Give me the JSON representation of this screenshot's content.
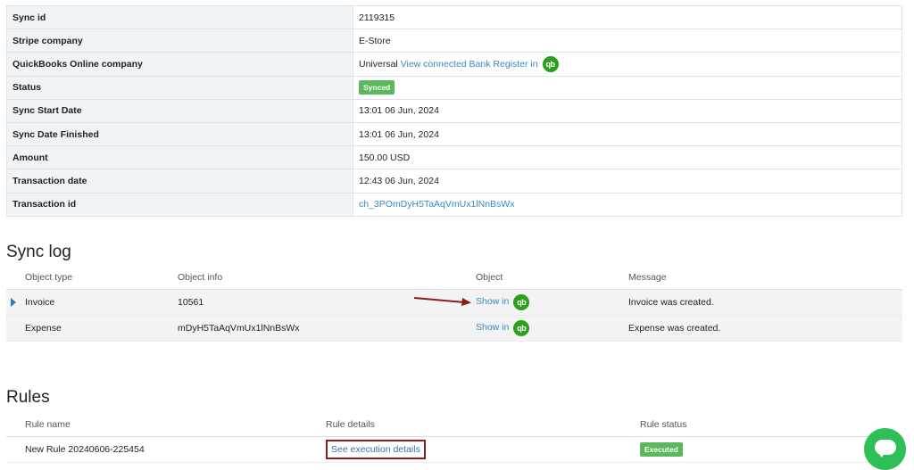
{
  "details": [
    {
      "label": "Sync id",
      "value": "2119315"
    },
    {
      "label": "Stripe company",
      "value": "E-Store"
    },
    {
      "label": "QuickBooks Online company",
      "value": "Universal",
      "link": "View connected Bank Register in",
      "icon": "quickbooks-icon"
    },
    {
      "label": "Status",
      "badge": "Synced"
    },
    {
      "label": "Sync Start Date",
      "value": "13:01 06 Jun, 2024"
    },
    {
      "label": "Sync Date Finished",
      "value": "13:01 06 Jun, 2024"
    },
    {
      "label": "Amount",
      "value": "150.00 USD"
    },
    {
      "label": "Transaction date",
      "value": "12:43 06 Jun, 2024"
    },
    {
      "label": "Transaction id",
      "link": "ch_3POmDyH5TaAqVmUx1lNnBsWx"
    }
  ],
  "sync_log": {
    "title": "Sync log",
    "columns": [
      "Object type",
      "Object info",
      "Object",
      "Message"
    ],
    "rows": [
      {
        "type": "Invoice",
        "info": "10561",
        "object": "Show in",
        "message": "Invoice was created.",
        "expand_icon": "caret-right-icon"
      },
      {
        "type": "Expense",
        "info": "mDyH5TaAqVmUx1lNnBsWx",
        "object": "Show in",
        "message": "Expense was created."
      }
    ]
  },
  "rules": {
    "title": "Rules",
    "columns": [
      "Rule name",
      "Rule details",
      "Rule status"
    ],
    "rows": [
      {
        "name": "New Rule 20240606-225454",
        "details": "See execution details",
        "status": "Executed"
      }
    ]
  },
  "colors": {
    "link": "#3b89c2",
    "badge_green": "#5cb85c",
    "qb_green": "#2ca01c",
    "annotation_red": "#8b1a1a",
    "chat_green": "#2fbf59"
  },
  "icons": {
    "chat": "chat-bubble-icon",
    "arrow": "annotation-arrow-icon"
  }
}
